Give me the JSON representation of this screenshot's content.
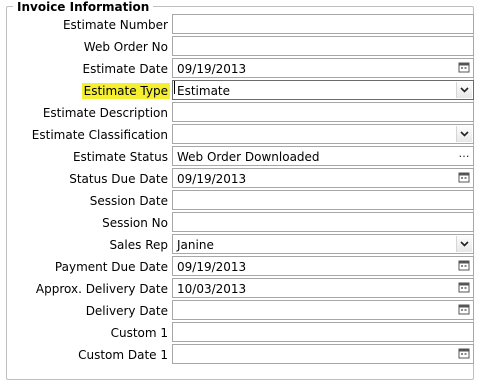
{
  "section": {
    "title": "Invoice Information"
  },
  "fields": [
    {
      "label": "Estimate Number",
      "value": "",
      "control": "text"
    },
    {
      "label": "Web Order No",
      "value": "",
      "control": "text"
    },
    {
      "label": "Estimate Date",
      "value": "09/19/2013",
      "control": "date"
    },
    {
      "label": "Estimate Type",
      "value": "Estimate",
      "control": "select",
      "highlighted": true,
      "focused": true
    },
    {
      "label": "Estimate Description",
      "value": "",
      "control": "text"
    },
    {
      "label": "Estimate Classification",
      "value": "",
      "control": "select"
    },
    {
      "label": "Estimate Status",
      "value": "Web Order Downloaded",
      "control": "lookup"
    },
    {
      "label": "Status Due Date",
      "value": "09/19/2013",
      "control": "date"
    },
    {
      "label": "Session Date",
      "value": "",
      "control": "text"
    },
    {
      "label": "Session No",
      "value": "",
      "control": "text"
    },
    {
      "label": "Sales Rep",
      "value": "Janine",
      "control": "select"
    },
    {
      "label": "Payment Due Date",
      "value": "09/19/2013",
      "control": "date"
    },
    {
      "label": "Approx. Delivery Date",
      "value": "10/03/2013",
      "control": "date"
    },
    {
      "label": "Delivery Date",
      "value": "",
      "control": "date"
    },
    {
      "label": "Custom 1",
      "value": "",
      "control": "text"
    },
    {
      "label": "Custom Date 1",
      "value": "",
      "control": "date"
    }
  ],
  "colors": {
    "highlight": "#f5ef2f",
    "border": "#a7a7a7"
  },
  "icons": {
    "date": "calendar-icon",
    "select": "chevron-down-icon",
    "lookup": "ellipsis-icon"
  }
}
